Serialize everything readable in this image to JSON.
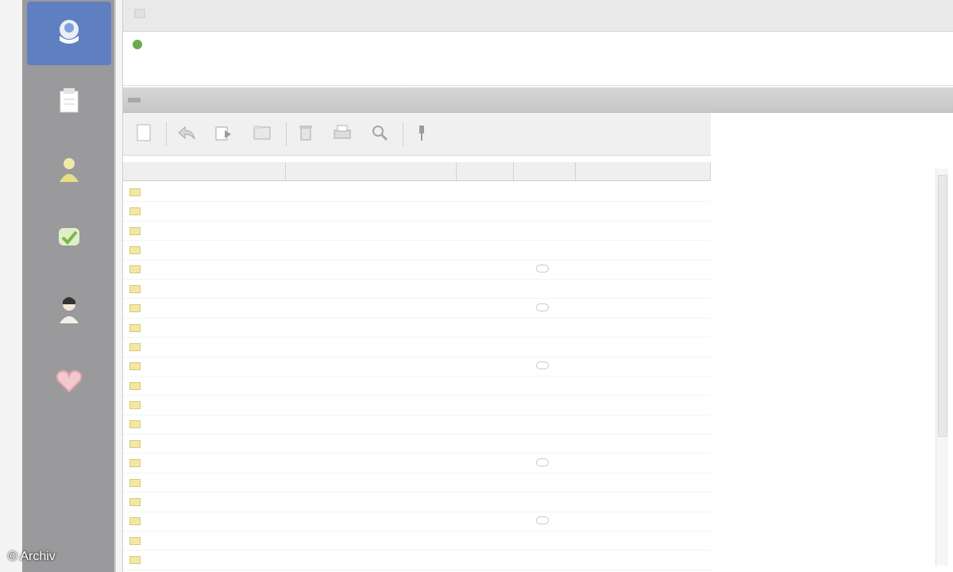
{
  "window": {
    "title": "",
    "address_left": "",
    "address_right": ""
  },
  "sidebar": {
    "items": [
      {
        "label": "",
        "icon": "mail-icon",
        "active": true
      },
      {
        "label": "",
        "icon": "notepad-icon",
        "active": false
      },
      {
        "label": "",
        "icon": "contacts-icon",
        "active": false
      },
      {
        "label": "",
        "icon": "tasks-icon",
        "active": false
      },
      {
        "label": "",
        "icon": "user-icon",
        "active": false
      },
      {
        "label": "",
        "icon": "heart-icon",
        "active": false
      }
    ]
  },
  "folder": {
    "title": ""
  },
  "toolbar": {
    "buttons": [
      {
        "name": "new-button",
        "label": "",
        "icon": "document-icon"
      },
      {
        "name": "reply-button",
        "label": "",
        "icon": "reply-icon"
      },
      {
        "name": "forward-button",
        "label": "",
        "icon": "forward-icon"
      },
      {
        "name": "move-button",
        "label": "",
        "icon": "folder-icon"
      },
      {
        "name": "delete-button",
        "label": "",
        "icon": "trash-icon"
      },
      {
        "name": "print-button",
        "label": "",
        "icon": "printer-icon"
      },
      {
        "name": "search-button",
        "label": "",
        "icon": "search-icon"
      },
      {
        "name": "more-button",
        "label": "",
        "icon": "pin-icon"
      }
    ]
  },
  "table": {
    "columns": [
      "",
      "",
      "",
      "",
      ""
    ],
    "rows": [
      {
        "from": "",
        "subject": "",
        "size": "",
        "flagged": false,
        "date": ""
      },
      {
        "from": "",
        "subject": "",
        "size": "",
        "flagged": false,
        "date": ""
      },
      {
        "from": "",
        "subject": "",
        "size": "",
        "flagged": false,
        "date": ""
      },
      {
        "from": "",
        "subject": "",
        "size": "",
        "flagged": false,
        "date": ""
      },
      {
        "from": "",
        "subject": "",
        "size": "",
        "flagged": true,
        "date": ""
      },
      {
        "from": "",
        "subject": "",
        "size": "",
        "flagged": false,
        "date": ""
      },
      {
        "from": "",
        "subject": "",
        "size": "",
        "flagged": true,
        "date": ""
      },
      {
        "from": "",
        "subject": "",
        "size": "",
        "flagged": false,
        "date": ""
      },
      {
        "from": "",
        "subject": "",
        "size": "",
        "flagged": false,
        "date": ""
      },
      {
        "from": "",
        "subject": "",
        "size": "",
        "flagged": true,
        "date": ""
      },
      {
        "from": "",
        "subject": "",
        "size": "",
        "flagged": false,
        "date": ""
      },
      {
        "from": "",
        "subject": "",
        "size": "",
        "flagged": false,
        "date": ""
      },
      {
        "from": "",
        "subject": "",
        "size": "",
        "flagged": false,
        "date": ""
      },
      {
        "from": "",
        "subject": "",
        "size": "",
        "flagged": false,
        "date": ""
      },
      {
        "from": "",
        "subject": "",
        "size": "",
        "flagged": true,
        "date": ""
      },
      {
        "from": "",
        "subject": "",
        "size": "",
        "flagged": false,
        "date": ""
      },
      {
        "from": "",
        "subject": "",
        "size": "",
        "flagged": false,
        "date": ""
      },
      {
        "from": "",
        "subject": "",
        "size": "",
        "flagged": true,
        "date": ""
      },
      {
        "from": "",
        "subject": "",
        "size": "",
        "flagged": false,
        "date": ""
      },
      {
        "from": "",
        "subject": "",
        "size": "",
        "flagged": false,
        "date": ""
      }
    ]
  },
  "copyright": "© Archiv",
  "colors": {
    "sidebar_bg": "#9a9a9c",
    "sidebar_active": "#5f7fc0",
    "envelope": "#f3e7a6"
  }
}
